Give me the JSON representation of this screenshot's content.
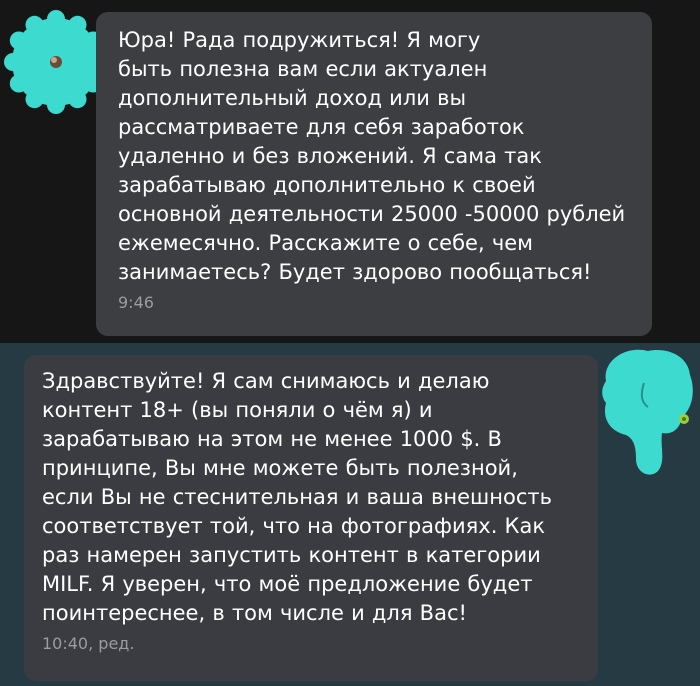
{
  "colors": {
    "top_background": "#161616",
    "bottom_background": "#263a44",
    "bubble": "#3d3e42",
    "avatar": "#3ddad0",
    "text": "#ffffff",
    "meta": "#9a9ca0"
  },
  "messages": [
    {
      "text": "Юра! Рада подружиться!  Я могу\nбыть полезна  вам если актуален\nдополнительный доход или вы\nрассматриваете для себя заработок\nудаленно и без вложений.  Я сама так\nзарабатываю дополнительно к своей\nосновной деятельности 25000 -50000 рублей\nежемесячно.  Расскажите о себе, чем\nзанимаетесь? Будет здорово пообщаться!",
      "time": "9:46",
      "avatar_icon": "flower-avatar-icon"
    },
    {
      "text": "Здравствуйте! Я сам снимаюсь и делаю\nконтент 18+ (вы поняли о чём я) и\nзарабатываю на этом не менее 1000 $. В\nпринципе, Вы мне можете быть полезной,\nесли Вы не стеснительная и ваша внешность\nсоответствует той, что на фотографиях. Как\nраз намерен запустить контент в категории\nMILF. Я уверен, что моё предложение будет\nпоинтереснее, в том числе и для Вас!",
      "time": "10:40, ред.",
      "avatar_icon": "blob-avatar-icon"
    }
  ]
}
